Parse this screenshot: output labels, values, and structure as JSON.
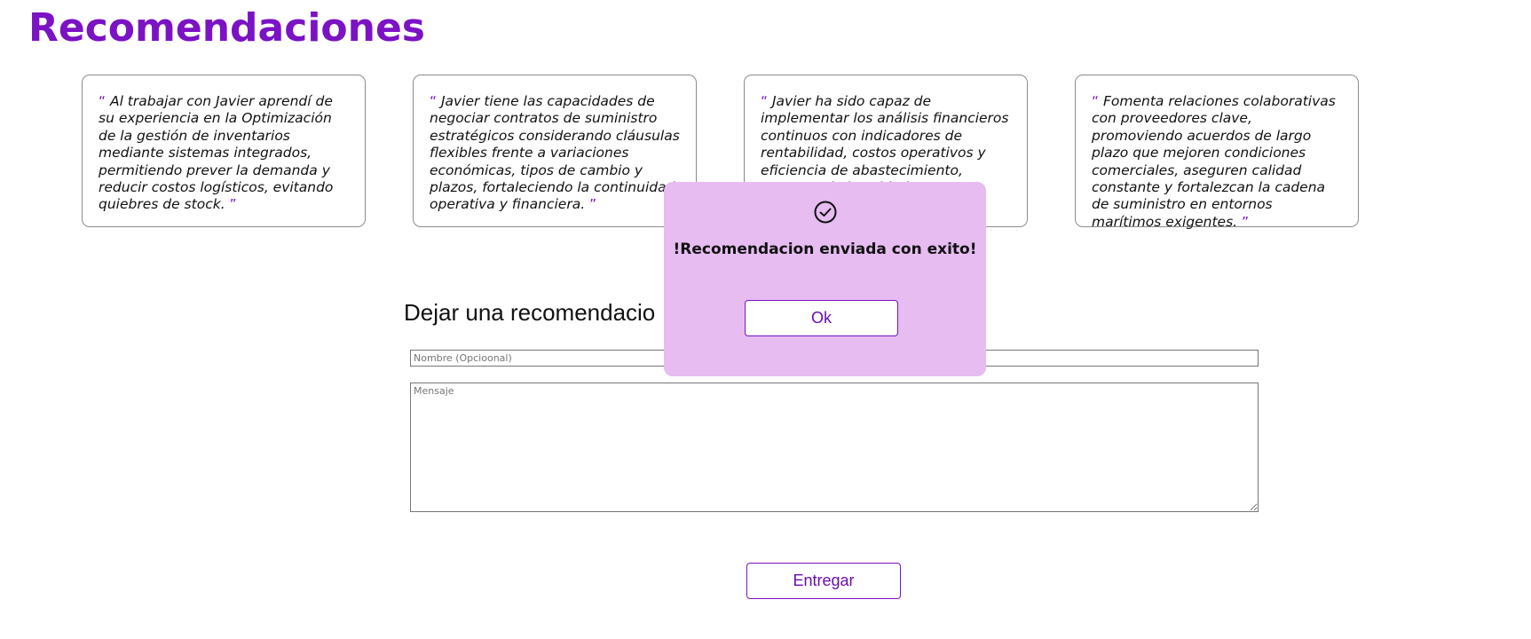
{
  "header": {
    "title": "Recomendaciones"
  },
  "recommendations": [
    {
      "open_quote": "“",
      "text": "Al trabajar con Javier aprendí de su experiencia en la Optimización de la gestión de inventarios mediante sistemas integrados, permitiendo prever la demanda y reducir costos logísticos, evitando quiebres de stock.",
      "close_quote": "”"
    },
    {
      "open_quote": "“",
      "text": "Javier tiene las capacidades de negociar contratos de suministro estratégicos considerando cláusulas flexibles frente a variaciones económicas, tipos de cambio y plazos, fortaleciendo la continuidad operativa y financiera.",
      "close_quote": "”"
    },
    {
      "open_quote": "“",
      "text": "Javier ha sido capaz de implementar los análisis financieros continuos con indicadores de rentabilidad, costos operativos y eficiencia de abastecimiento, asegurando los objetivos comerciales y",
      "close_quote": "”"
    },
    {
      "open_quote": "“",
      "text": "Fomenta relaciones colaborativas con proveedores clave, promoviendo acuerdos de largo plazo que mejoren condiciones comerciales, aseguren calidad constante y fortalezcan la cadena de suministro en entornos marítimos exigentes.",
      "close_quote": "”"
    }
  ],
  "form": {
    "title": "Dejar una recomendacio",
    "name_placeholder": "Nombre (Opcioonal)",
    "name_value": "",
    "message_placeholder": "Mensaje",
    "message_value": "",
    "submit_label": "Entregar"
  },
  "modal": {
    "icon": "check-circle-icon",
    "message": "!Recomendacion enviada con exito!",
    "ok_label": "Ok"
  },
  "colors": {
    "accent": "#7b12c4",
    "modal_background": "#e6bcf1",
    "button_text": "#6a0dad"
  }
}
